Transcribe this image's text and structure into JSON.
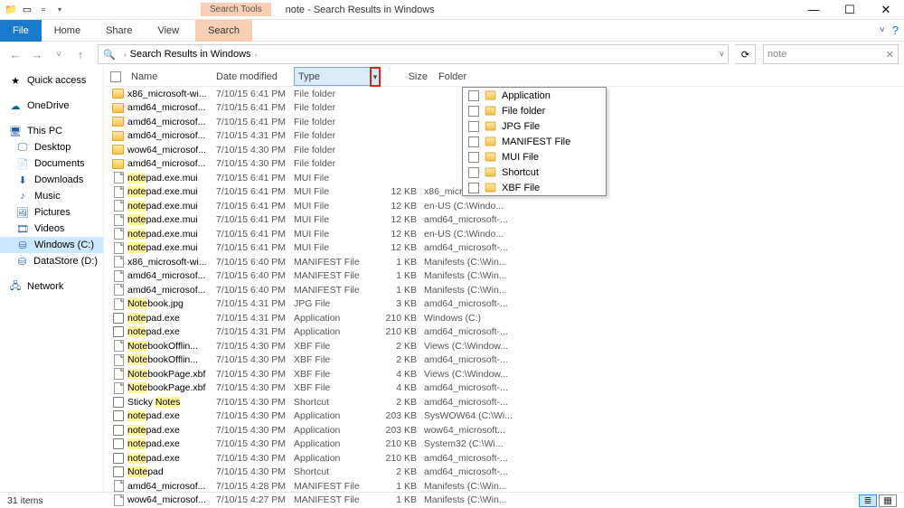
{
  "title_bar": {
    "search_tools_label": "Search Tools",
    "window_title": "note - Search Results in Windows"
  },
  "ribbon": {
    "file": "File",
    "home": "Home",
    "share": "Share",
    "view": "View",
    "search": "Search"
  },
  "breadcrumb": {
    "path": "Search Results in Windows"
  },
  "search": {
    "value": "note"
  },
  "sidebar": {
    "quick_access": "Quick access",
    "onedrive": "OneDrive",
    "this_pc": "This PC",
    "items": [
      {
        "label": "Desktop",
        "icon": "desktop"
      },
      {
        "label": "Documents",
        "icon": "folder"
      },
      {
        "label": "Downloads",
        "icon": "download"
      },
      {
        "label": "Music",
        "icon": "music"
      },
      {
        "label": "Pictures",
        "icon": "picture"
      },
      {
        "label": "Videos",
        "icon": "video"
      },
      {
        "label": "Windows (C:)",
        "icon": "drive",
        "selected": true
      },
      {
        "label": "DataStore (D:)",
        "icon": "drive"
      }
    ],
    "network": "Network"
  },
  "columns": {
    "name": "Name",
    "date": "Date modified",
    "type": "Type",
    "size": "Size",
    "folder": "Folder"
  },
  "type_filter": {
    "options": [
      "Application",
      "File folder",
      "JPG File",
      "MANIFEST File",
      "MUI File",
      "Shortcut",
      "XBF File"
    ]
  },
  "files": [
    {
      "name": "x86_microsoft-wi...",
      "date": "7/10/15 6:41 PM",
      "type": "File folder",
      "size": "",
      "folder": "",
      "icon": "folder",
      "hl": false
    },
    {
      "name": "amd64_microsof...",
      "date": "7/10/15 6:41 PM",
      "type": "File folder",
      "size": "",
      "folder": "",
      "icon": "folder",
      "hl": false
    },
    {
      "name": "amd64_microsof...",
      "date": "7/10/15 6:41 PM",
      "type": "File folder",
      "size": "",
      "folder": "",
      "icon": "folder",
      "hl": false
    },
    {
      "name": "amd64_microsof...",
      "date": "7/10/15 4:31 PM",
      "type": "File folder",
      "size": "",
      "folder": "",
      "icon": "folder",
      "hl": false
    },
    {
      "name": "wow64_microsof...",
      "date": "7/10/15 4:30 PM",
      "type": "File folder",
      "size": "",
      "folder": "",
      "icon": "folder",
      "hl": false
    },
    {
      "name": "amd64_microsof...",
      "date": "7/10/15 4:30 PM",
      "type": "File folder",
      "size": "",
      "folder": "",
      "icon": "folder",
      "hl": false
    },
    {
      "name": "notepad.exe.mui",
      "date": "7/10/15 6:41 PM",
      "type": "MUI File",
      "size": "",
      "folder": "",
      "icon": "file",
      "hl": true
    },
    {
      "name": "notepad.exe.mui",
      "date": "7/10/15 6:41 PM",
      "type": "MUI File",
      "size": "12 KB",
      "folder": "x86_microsoft-win...",
      "icon": "file",
      "hl": true
    },
    {
      "name": "notepad.exe.mui",
      "date": "7/10/15 6:41 PM",
      "type": "MUI File",
      "size": "12 KB",
      "folder": "en-US (C:\\Windo...",
      "icon": "file",
      "hl": true
    },
    {
      "name": "notepad.exe.mui",
      "date": "7/10/15 6:41 PM",
      "type": "MUI File",
      "size": "12 KB",
      "folder": "amd64_microsoft-...",
      "icon": "file",
      "hl": true
    },
    {
      "name": "notepad.exe.mui",
      "date": "7/10/15 6:41 PM",
      "type": "MUI File",
      "size": "12 KB",
      "folder": "en-US (C:\\Windo...",
      "icon": "file",
      "hl": true
    },
    {
      "name": "notepad.exe.mui",
      "date": "7/10/15 6:41 PM",
      "type": "MUI File",
      "size": "12 KB",
      "folder": "amd64_microsoft-...",
      "icon": "file",
      "hl": true
    },
    {
      "name": "x86_microsoft-wi...",
      "date": "7/10/15 6:40 PM",
      "type": "MANIFEST File",
      "size": "1 KB",
      "folder": "Manifests (C:\\Win...",
      "icon": "file",
      "hl": false
    },
    {
      "name": "amd64_microsof...",
      "date": "7/10/15 6:40 PM",
      "type": "MANIFEST File",
      "size": "1 KB",
      "folder": "Manifests (C:\\Win...",
      "icon": "file",
      "hl": false
    },
    {
      "name": "amd64_microsof...",
      "date": "7/10/15 6:40 PM",
      "type": "MANIFEST File",
      "size": "1 KB",
      "folder": "Manifests (C:\\Win...",
      "icon": "file",
      "hl": false
    },
    {
      "name": "Notebook.jpg",
      "date": "7/10/15 4:31 PM",
      "type": "JPG File",
      "size": "3 KB",
      "folder": "amd64_microsoft-...",
      "icon": "file",
      "hl": true,
      "hlPart": "Note"
    },
    {
      "name": "notepad.exe",
      "date": "7/10/15 4:31 PM",
      "type": "Application",
      "size": "210 KB",
      "folder": "Windows (C:)",
      "icon": "exe",
      "hl": true
    },
    {
      "name": "notepad.exe",
      "date": "7/10/15 4:31 PM",
      "type": "Application",
      "size": "210 KB",
      "folder": "amd64_microsoft-...",
      "icon": "exe",
      "hl": true
    },
    {
      "name": "NotebookOfflin...",
      "date": "7/10/15 4:30 PM",
      "type": "XBF File",
      "size": "2 KB",
      "folder": "Views (C:\\Window...",
      "icon": "file",
      "hl": true,
      "hlPart": "Note"
    },
    {
      "name": "NotebookOfflin...",
      "date": "7/10/15 4:30 PM",
      "type": "XBF File",
      "size": "2 KB",
      "folder": "amd64_microsoft-...",
      "icon": "file",
      "hl": true,
      "hlPart": "Note"
    },
    {
      "name": "NotebookPage.xbf",
      "date": "7/10/15 4:30 PM",
      "type": "XBF File",
      "size": "4 KB",
      "folder": "Views (C:\\Window...",
      "icon": "file",
      "hl": true,
      "hlPart": "Note"
    },
    {
      "name": "NotebookPage.xbf",
      "date": "7/10/15 4:30 PM",
      "type": "XBF File",
      "size": "4 KB",
      "folder": "amd64_microsoft-...",
      "icon": "file",
      "hl": true,
      "hlPart": "Note"
    },
    {
      "name": "Sticky Notes",
      "date": "7/10/15 4:30 PM",
      "type": "Shortcut",
      "size": "2 KB",
      "folder": "amd64_microsoft-...",
      "icon": "exe",
      "hl": true,
      "hlPart": "Notes",
      "pre": "Sticky "
    },
    {
      "name": "notepad.exe",
      "date": "7/10/15 4:30 PM",
      "type": "Application",
      "size": "203 KB",
      "folder": "SysWOW64 (C:\\Wi...",
      "icon": "exe",
      "hl": true
    },
    {
      "name": "notepad.exe",
      "date": "7/10/15 4:30 PM",
      "type": "Application",
      "size": "203 KB",
      "folder": "wow64_microsoft...",
      "icon": "exe",
      "hl": true
    },
    {
      "name": "notepad.exe",
      "date": "7/10/15 4:30 PM",
      "type": "Application",
      "size": "210 KB",
      "folder": "System32 (C:\\Wi...",
      "icon": "exe",
      "hl": true
    },
    {
      "name": "notepad.exe",
      "date": "7/10/15 4:30 PM",
      "type": "Application",
      "size": "210 KB",
      "folder": "amd64_microsoft-...",
      "icon": "exe",
      "hl": true
    },
    {
      "name": "Notepad",
      "date": "7/10/15 4:30 PM",
      "type": "Shortcut",
      "size": "2 KB",
      "folder": "amd64_microsoft-...",
      "icon": "exe",
      "hl": true,
      "hlPart": "Note"
    },
    {
      "name": "amd64_microsof...",
      "date": "7/10/15 4:28 PM",
      "type": "MANIFEST File",
      "size": "1 KB",
      "folder": "Manifests (C:\\Win...",
      "icon": "file",
      "hl": false
    },
    {
      "name": "wow64_microsof...",
      "date": "7/10/15 4:27 PM",
      "type": "MANIFEST File",
      "size": "1 KB",
      "folder": "Manifests (C:\\Win...",
      "icon": "file",
      "hl": false
    }
  ],
  "status": {
    "count": "31 items"
  }
}
